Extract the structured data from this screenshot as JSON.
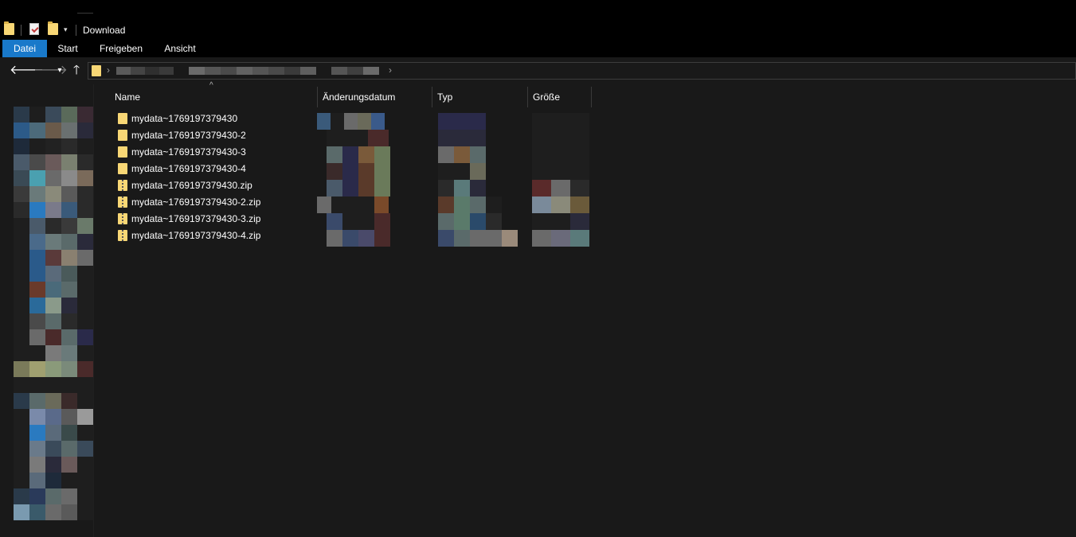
{
  "window": {
    "title": "Download"
  },
  "ribbon": {
    "tabs": [
      {
        "label": "Datei",
        "active": true
      },
      {
        "label": "Start",
        "active": false
      },
      {
        "label": "Freigeben",
        "active": false
      },
      {
        "label": "Ansicht",
        "active": false
      }
    ]
  },
  "nav": {
    "back_icon": "arrow-left-icon",
    "forward_icon": "arrow-right-icon",
    "recent_icon": "chevron-down-icon",
    "up_icon": "arrow-up-icon"
  },
  "columns": {
    "name": "Name",
    "modified": "Änderungsdatum",
    "type": "Typ",
    "size": "Größe"
  },
  "files": [
    {
      "name": "mydata~1769197379430",
      "kind": "folder"
    },
    {
      "name": "mydata~1769197379430-2",
      "kind": "folder"
    },
    {
      "name": "mydata~1769197379430-3",
      "kind": "folder"
    },
    {
      "name": "mydata~1769197379430-4",
      "kind": "folder"
    },
    {
      "name": "mydata~1769197379430.zip",
      "kind": "zip"
    },
    {
      "name": "mydata~1769197379430-2.zip",
      "kind": "zip"
    },
    {
      "name": "mydata~1769197379430-3.zip",
      "kind": "zip"
    },
    {
      "name": "mydata~1769197379430-4.zip",
      "kind": "zip"
    }
  ],
  "colors": {
    "accent": "#1979ca",
    "background": "#191919",
    "folder": "#f8d775"
  }
}
